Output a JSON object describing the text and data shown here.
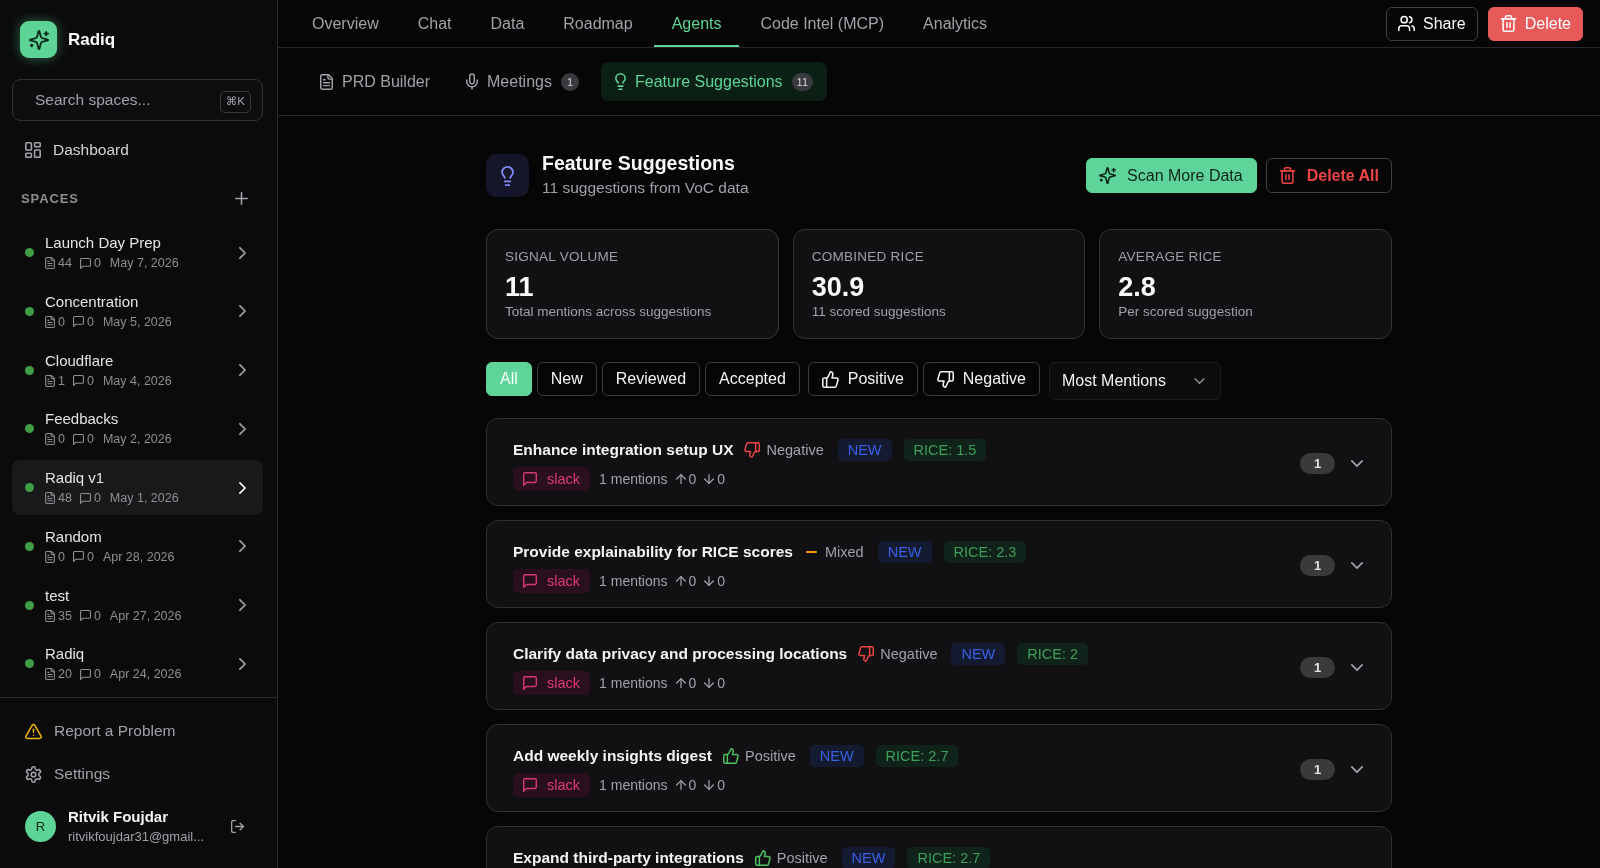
{
  "sidebar": {
    "brand": {
      "name": "Radiq"
    },
    "search": {
      "placeholder": "Search spaces...",
      "shortcut": "⌘K"
    },
    "dashboard": {
      "label": "Dashboard"
    },
    "spaces": {
      "heading": "SPACES",
      "items": [
        {
          "name": "Launch Day Prep",
          "files": "44",
          "comments": "0",
          "date": "May 7, 2026",
          "color": "#3f9e46",
          "selected": false
        },
        {
          "name": "Concentration",
          "files": "0",
          "comments": "0",
          "date": "May 5, 2026",
          "color": "#3f9e46",
          "selected": false
        },
        {
          "name": "Cloudflare",
          "files": "1",
          "comments": "0",
          "date": "May 4, 2026",
          "color": "#3f9e46",
          "selected": false
        },
        {
          "name": "Feedbacks",
          "files": "0",
          "comments": "0",
          "date": "May 2, 2026",
          "color": "#3f9e46",
          "selected": false
        },
        {
          "name": "Radiq v1",
          "files": "48",
          "comments": "0",
          "date": "May 1, 2026",
          "color": "#3f9e46",
          "selected": true
        },
        {
          "name": "Random",
          "files": "0",
          "comments": "0",
          "date": "Apr 28, 2026",
          "color": "#3f9e46",
          "selected": false
        },
        {
          "name": "test",
          "files": "35",
          "comments": "0",
          "date": "Apr 27, 2026",
          "color": "#3f9e46",
          "selected": false
        },
        {
          "name": "Radiq",
          "files": "20",
          "comments": "0",
          "date": "Apr 24, 2026",
          "color": "#3f9e46",
          "selected": false
        }
      ]
    },
    "links": [
      {
        "kind": "report",
        "label": "Report a Problem"
      },
      {
        "kind": "settings",
        "label": "Settings"
      }
    ],
    "user": {
      "initial": "R",
      "name": "Ritvik Foujdar",
      "email": "ritvikfoujdar31@gmail..."
    }
  },
  "top_tabs": [
    {
      "label": "Overview",
      "selected": false
    },
    {
      "label": "Chat",
      "selected": false
    },
    {
      "label": "Data",
      "selected": false
    },
    {
      "label": "Roadmap",
      "selected": false
    },
    {
      "label": "Agents",
      "selected": true
    },
    {
      "label": "Code Intel (MCP)",
      "selected": false
    },
    {
      "label": "Analytics",
      "selected": false
    }
  ],
  "actions": [
    {
      "kind": "share",
      "label": "Share"
    },
    {
      "kind": "delete",
      "label": "Delete"
    }
  ],
  "sub_tabs": [
    {
      "kind": "prd",
      "label": "PRD Builder",
      "selected": false
    },
    {
      "kind": "meetings",
      "label": "Meetings",
      "count": "1",
      "selected": false
    },
    {
      "kind": "suggestions",
      "label": "Feature Suggestions",
      "count": "11",
      "selected": true
    }
  ],
  "header": {
    "title": "Feature Suggestions",
    "subtitle": "11 suggestions from VoC data",
    "buttons": [
      {
        "kind": "scan",
        "label": "Scan More Data"
      },
      {
        "kind": "delete",
        "label": "Delete All"
      }
    ]
  },
  "stats": [
    {
      "label": "SIGNAL VOLUME",
      "value": "11",
      "caption": "Total mentions across suggestions"
    },
    {
      "label": "COMBINED RICE",
      "value": "30.9",
      "caption": "11 scored suggestions"
    },
    {
      "label": "AVERAGE RICE",
      "value": "2.8",
      "caption": "Per scored suggestion"
    }
  ],
  "filters": [
    {
      "kind": "status",
      "label": "All",
      "selected": true
    },
    {
      "kind": "status",
      "label": "New",
      "selected": false
    },
    {
      "kind": "status",
      "label": "Reviewed",
      "selected": false
    },
    {
      "kind": "status",
      "label": "Accepted",
      "selected": false
    },
    {
      "kind": "positive",
      "label": "Positive",
      "selected": false
    },
    {
      "kind": "negative",
      "label": "Negative",
      "selected": false
    }
  ],
  "sort": {
    "value": "Most Mentions"
  },
  "suggestions": [
    {
      "title": "Enhance integration setup UX",
      "sentiment": {
        "kind": "negative",
        "label": "Negative"
      },
      "status": "NEW",
      "rice": "RICE: 1.5",
      "source": "slack",
      "mentions": "1 mentions",
      "upvotes": "0",
      "downvotes": "0",
      "count": "1"
    },
    {
      "title": "Provide explainability for RICE scores",
      "sentiment": {
        "kind": "mixed",
        "label": "Mixed"
      },
      "status": "NEW",
      "rice": "RICE: 2.3",
      "source": "slack",
      "mentions": "1 mentions",
      "upvotes": "0",
      "downvotes": "0",
      "count": "1"
    },
    {
      "title": "Clarify data privacy and processing locations",
      "sentiment": {
        "kind": "negative",
        "label": "Negative"
      },
      "status": "NEW",
      "rice": "RICE: 2",
      "source": "slack",
      "mentions": "1 mentions",
      "upvotes": "0",
      "downvotes": "0",
      "count": "1"
    },
    {
      "title": "Add weekly insights digest",
      "sentiment": {
        "kind": "positive",
        "label": "Positive"
      },
      "status": "NEW",
      "rice": "RICE: 2.7",
      "source": "slack",
      "mentions": "1 mentions",
      "upvotes": "0",
      "downvotes": "0",
      "count": "1"
    },
    {
      "title": "Expand third-party integrations",
      "sentiment": {
        "kind": "positive",
        "label": "Positive"
      },
      "status": "NEW",
      "rice": "RICE: 2.7"
    }
  ]
}
